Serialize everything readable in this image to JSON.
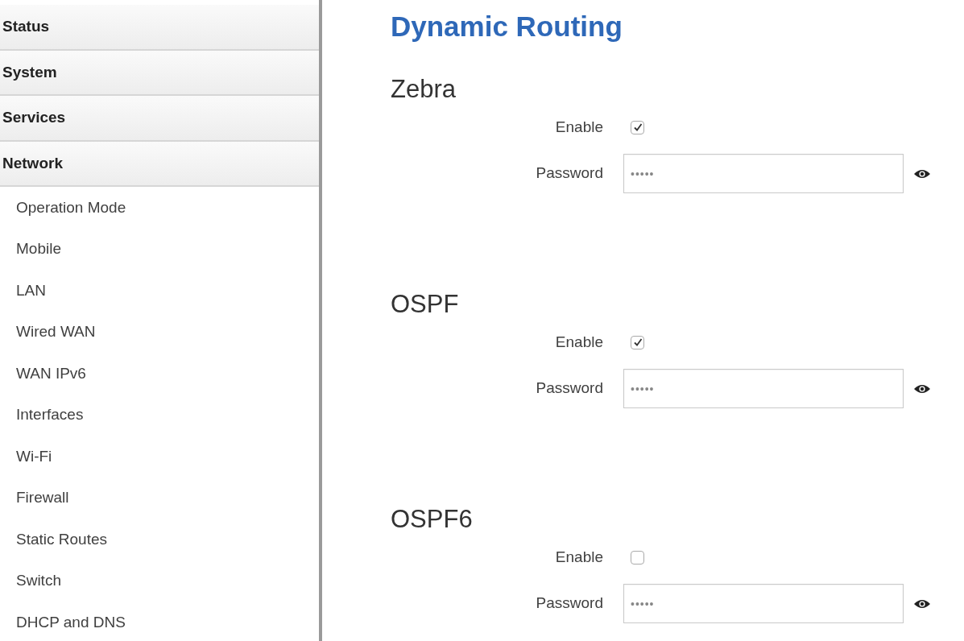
{
  "sidebar": {
    "groups": [
      {
        "label": "Status"
      },
      {
        "label": "System"
      },
      {
        "label": "Services"
      },
      {
        "label": "Network"
      }
    ],
    "items": [
      {
        "label": "Operation Mode"
      },
      {
        "label": "Mobile"
      },
      {
        "label": "LAN"
      },
      {
        "label": "Wired WAN"
      },
      {
        "label": "WAN IPv6"
      },
      {
        "label": "Interfaces"
      },
      {
        "label": "Wi-Fi"
      },
      {
        "label": "Firewall"
      },
      {
        "label": "Static Routes"
      },
      {
        "label": "Switch"
      },
      {
        "label": "DHCP and DNS"
      }
    ]
  },
  "page_title": "Dynamic Routing",
  "sections": [
    {
      "title": "Zebra",
      "enable_label": "Enable",
      "enabled": true,
      "password_label": "Password",
      "password_value": "•••••"
    },
    {
      "title": "OSPF",
      "enable_label": "Enable",
      "enabled": true,
      "password_label": "Password",
      "password_value": "•••••"
    },
    {
      "title": "OSPF6",
      "enable_label": "Enable",
      "enabled": false,
      "password_label": "Password",
      "password_value": "•••••"
    }
  ]
}
